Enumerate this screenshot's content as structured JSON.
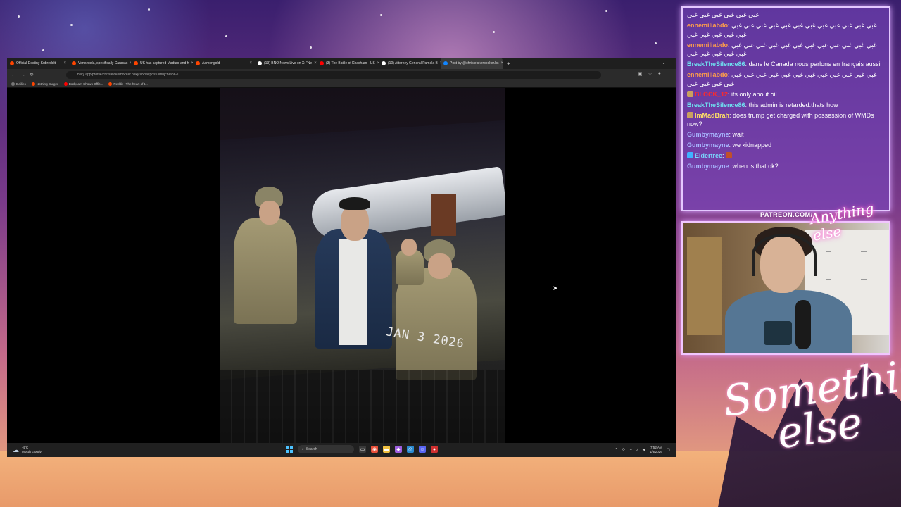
{
  "browser": {
    "tabs": [
      {
        "title": "Official Destiny Subreddit",
        "color": "#ff4500"
      },
      {
        "title": "Venezuela, specifically Caracas",
        "color": "#ff4500"
      },
      {
        "title": "US has captured Maduro and h",
        "color": "#ff4500"
      },
      {
        "title": "Aamongold",
        "color": "#ff4500"
      },
      {
        "title": "(13) BNO News Live on X: \"Ne",
        "color": "#ffffff"
      },
      {
        "title": "(3) The Battle of Khasham - US",
        "color": "#ff0000"
      },
      {
        "title": "(10) Attorney General Pamela B",
        "color": "#ffffff"
      },
      {
        "title": "Post by @chrisleickerbocker.bs",
        "color": "#1185fe"
      }
    ],
    "url": "bsky.app/profile/chrisleickerbocker.bsky.social/post/3mbjcr9ap62i",
    "bookmarks": [
      {
        "label": "Dailies",
        "color": "#777777"
      },
      {
        "label": "Nothing Burger",
        "color": "#ff4500"
      },
      {
        "label": "Bodycam Shows Offic...",
        "color": "#ff0000"
      },
      {
        "label": "Reddit - The heart of t...",
        "color": "#ff4500"
      }
    ],
    "image_date_stamp": "JAN 3 2026"
  },
  "taskbar": {
    "weather_temp": "-4°C",
    "weather_desc": "Mostly cloudy",
    "search_label": "Search",
    "time": "7:52 AM",
    "date": "1/3/2026"
  },
  "chat": {
    "messages": [
      {
        "user": "",
        "color": "#ffffff",
        "text": "غبي غبي غبي غبي غبي غبي"
      },
      {
        "user": "ennemiliabdo",
        "color": "#ff9f4a",
        "text": "غبي غبي غبي غبي غبي غبي غبي غبي غبي غبي غبي غبي غبي غبي غبي غبي غبي"
      },
      {
        "user": "ennemiliabdo",
        "color": "#ff9f4a",
        "text": "غبي غبي غبي غبي غبي غبي غبي غبي غبي غبي غبي غبي غبي غبي غبي غبي غبي"
      },
      {
        "user": "BreakTheSilence86",
        "color": "#6fe0f0",
        "text": "dans le Canada nous parlons en français aussi"
      },
      {
        "user": "ennemiliabdo",
        "color": "#ff9f4a",
        "text": "غبي غبي غبي غبي غبي غبي غبي غبي غبي غبي غبي غبي غبي غبي غبي غبي"
      },
      {
        "user": "BLOCK_12",
        "color": "#ff2a2a",
        "text": "its only about oil"
      },
      {
        "user": "BreakTheSilence86",
        "color": "#6fe0f0",
        "text": "this admin is retarded.thats how"
      },
      {
        "user": "ImMadBrah",
        "color": "#ffe066",
        "text": "does trump get charged with possession of WMDs now?"
      },
      {
        "user": "Gumbymayne",
        "color": "#a8b8ff",
        "text": "wait"
      },
      {
        "user": "Gumbymayne",
        "color": "#a8b8ff",
        "text": "we kidnapped"
      },
      {
        "user": "Eldertree",
        "color": "#7ad9ff",
        "text": ""
      },
      {
        "user": "Gumbymayne",
        "color": "#a8b8ff",
        "text": "when is that ok?"
      }
    ]
  },
  "overlay": {
    "patreon": "PATREON.COM/",
    "anything_else": "Anything else",
    "logo_line1": "Something",
    "logo_line2": "else"
  },
  "colors": {
    "chat_border": "#e4c8ff",
    "accent_pink": "#ff6ad5"
  }
}
